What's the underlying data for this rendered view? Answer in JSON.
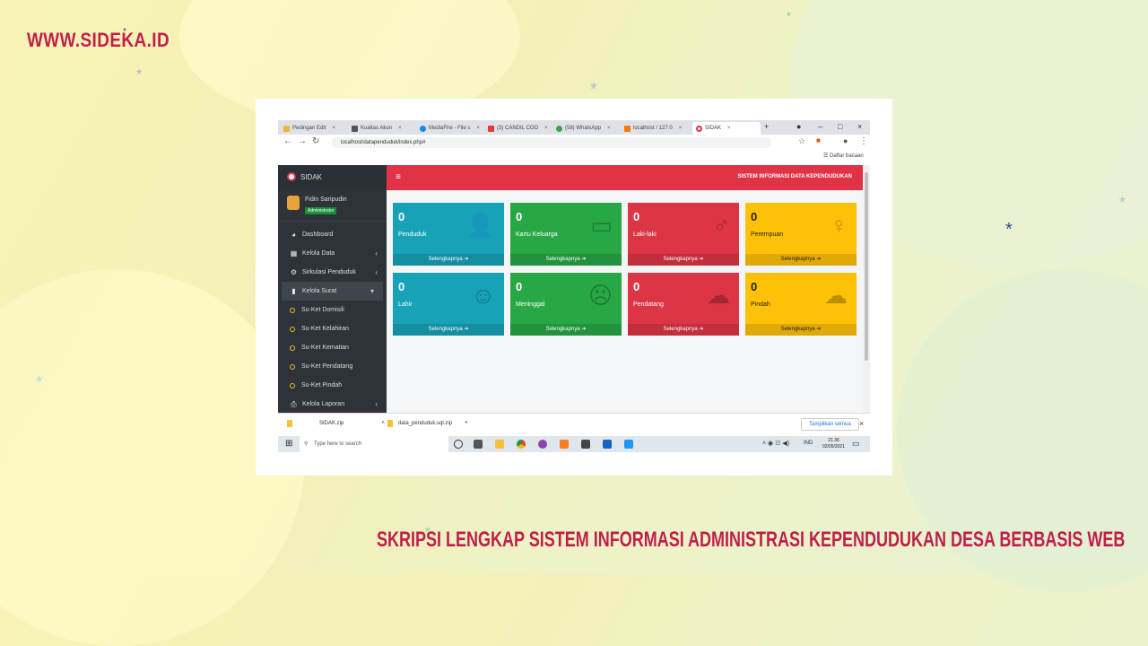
{
  "site": "WWW.SIDEKA.ID",
  "headline": "SKRIPSI LENGKAP SISTEM INFORMASI ADMINISTRASI KEPENDUDUKAN DESA BERBASIS WEB",
  "colors": {
    "accent": "#c01f4c",
    "cyan": "#17a2b8",
    "green": "#28a745",
    "red": "#dc3545",
    "yellow": "#ffc107",
    "sidebar": "#2d3338"
  },
  "browser": {
    "tabs": [
      "Pedingan Edit",
      "Kuaitas Akun",
      "MediaFire - File s",
      "(3) CANDIL COO",
      "(58) WhatsApp",
      "localhost / 127.0",
      "SIDAK"
    ],
    "url": "localhost/datapenduduk/index.php#",
    "reading_list": "Daftar bacaan",
    "new_tab": "+"
  },
  "app": {
    "brand": "SIDAK",
    "user": {
      "name": "Fidin Saripudin",
      "role": "Administrator"
    },
    "topbar_title": "SISTEM INFORMASI DATA KEPENDUDUKAN",
    "menu": [
      {
        "label": "Dashboard",
        "icon": "dashboard-icon"
      },
      {
        "label": "Kelola Data",
        "icon": "table-icon"
      },
      {
        "label": "Sirkulasi Penduduk",
        "icon": "cogs-icon"
      },
      {
        "label": "Kelola Surat",
        "icon": "file-icon"
      },
      {
        "label": "Su-Ket Domisili"
      },
      {
        "label": "Su-Ket Kelahiran"
      },
      {
        "label": "Su-Ket Kematian"
      },
      {
        "label": "Su-Ket Pendatang"
      },
      {
        "label": "Su-Ket Pindah"
      },
      {
        "label": "Kelola Laporan",
        "icon": "print-icon"
      }
    ],
    "cards": [
      {
        "value": "0",
        "label": "Penduduk",
        "icon": "user-plus-icon",
        "more": "Selengkapnya"
      },
      {
        "value": "0",
        "label": "Kartu Keluarga",
        "icon": "id-card-icon",
        "more": "Selengkapnya"
      },
      {
        "value": "0",
        "label": "Laki-laki",
        "icon": "male-icon",
        "more": "Selengkapnya"
      },
      {
        "value": "0",
        "label": "Perempuan",
        "icon": "female-icon",
        "more": "Selengkapnya"
      },
      {
        "value": "0",
        "label": "Lahir",
        "icon": "smile-icon",
        "more": "Selengkapnya"
      },
      {
        "value": "0",
        "label": "Meninggal",
        "icon": "sad-icon",
        "more": "Selengkapnya"
      },
      {
        "value": "0",
        "label": "Pendatang",
        "icon": "cloud-download-icon",
        "more": "Selengkapnya"
      },
      {
        "value": "0",
        "label": "Pindah",
        "icon": "cloud-upload-icon",
        "more": "Selengkapnya"
      }
    ]
  },
  "downloads": {
    "items": [
      "SIDAK.zip",
      "data_penduduk.sql.zip"
    ],
    "show_all": "Tampilkan semua"
  },
  "taskbar": {
    "search_placeholder": "Type here to search",
    "lang": "IND",
    "time": "21.36",
    "date": "02/05/2021"
  }
}
